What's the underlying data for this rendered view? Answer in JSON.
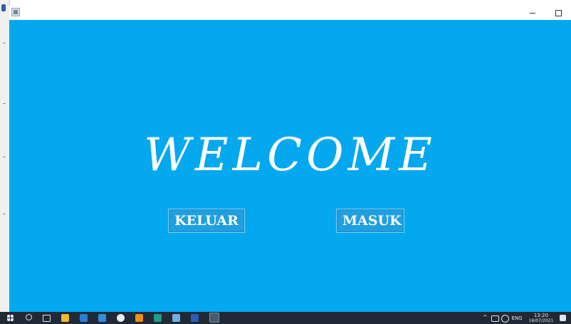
{
  "window": {
    "content": {
      "welcome_text": "WELCOME",
      "keluar_label": "KELUAR",
      "masuk_label": "MASUK",
      "background_color": "#03a8ef"
    }
  },
  "taskbar": {
    "icons": [
      "windows-start-icon",
      "search-icon",
      "task-view-icon",
      "file-explorer-icon",
      "store-icon",
      "mail-icon",
      "app-icon",
      "sublime-icon",
      "media-icon",
      "app-icon-2",
      "word-icon",
      "java-app-icon"
    ],
    "tray": {
      "language": "ENG",
      "time": "13:20",
      "date": "16/07/2021"
    }
  }
}
